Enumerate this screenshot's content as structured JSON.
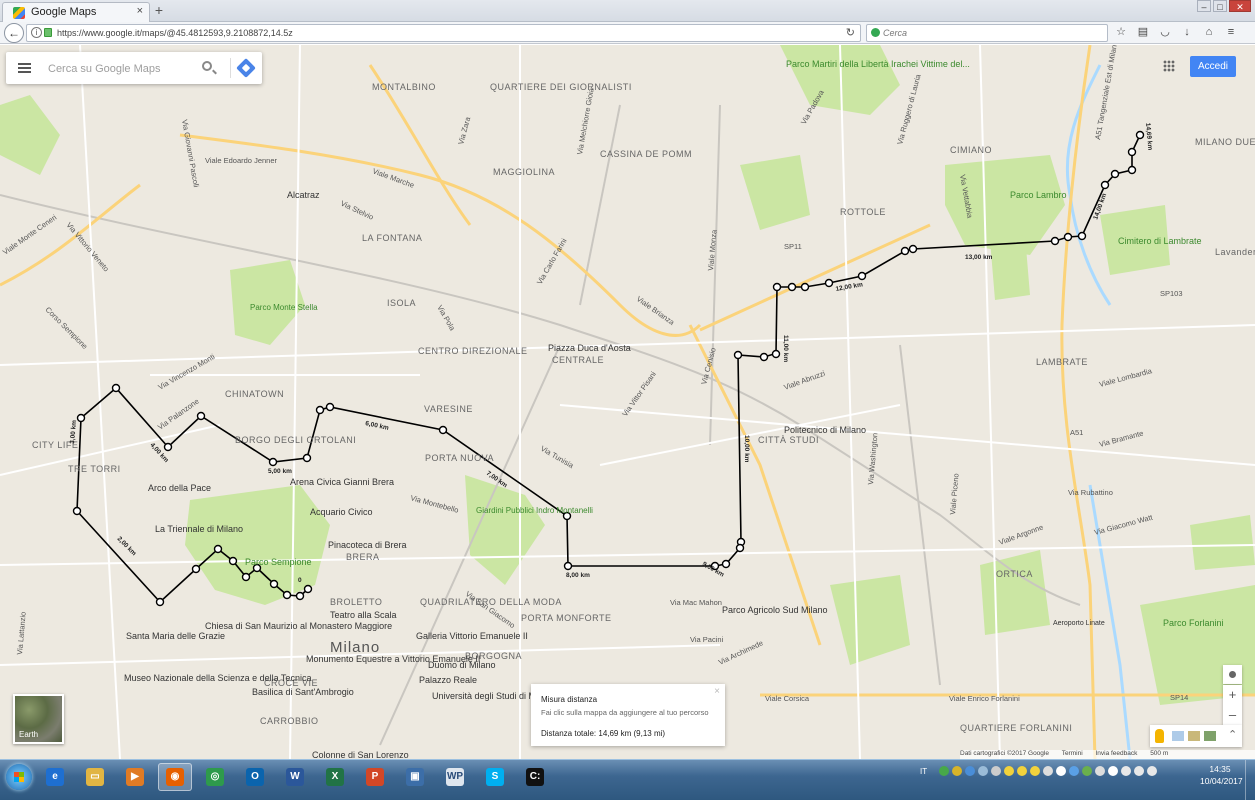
{
  "browser": {
    "tab_title": "Google Maps",
    "tab_close": "×",
    "new_tab": "+",
    "url": "https://www.google.it/maps/@45.4812593,9.2108872,14.5z",
    "search_placeholder": "Cerca",
    "window_buttons": [
      "–",
      "□",
      "✕"
    ]
  },
  "maps": {
    "search_placeholder": "Cerca su Google Maps",
    "sign_in": "Accedi",
    "earth_label": "Earth",
    "zoom_in": "+",
    "zoom_out": "–",
    "measure": {
      "title": "Misura distanza",
      "hint": "Fai clic sulla mappa da aggiungere al tuo percorso",
      "total": "Distanza totale: 14,69 km (9,13 mi)",
      "close": "×"
    },
    "footer": {
      "data": "Dati cartografici ©2017 Google",
      "terms": "Termini",
      "feedback": "Invia feedback",
      "scale": "500 m"
    },
    "district_labels": [
      "MONTALBINO",
      "QUARTIERE DEI GIORNALISTI",
      "CASSINA DE POMM",
      "MAGGIOLINA",
      "CIMIANO",
      "ROTTOLE",
      "LA FONTANA",
      "ISOLA",
      "CENTRO DIREZIONALE",
      "CENTRALE",
      "LAMBRATE",
      "CHINATOWN",
      "BORGO DEGLI ORTOLANI",
      "VARESINE",
      "PORTA NUOVA",
      "CITY LIFE",
      "TRE TORRI",
      "CITTÀ STUDI",
      "ORTICA",
      "BRERA",
      "BROLETTO",
      "QUADRILATERO DELLA MODA",
      "PORTA MONFORTE",
      "BORGOGNA",
      "CROCE VIE",
      "CARROBBIO",
      "QUARTIERE FORLANINI",
      "Milano",
      "MILANO DUE",
      "Lavander"
    ],
    "place_labels": [
      "Parco Monte Stella",
      "Alcatraz",
      "Parco Lambro",
      "Cimitero di Lambrate",
      "Piazza Duca d'Aosta",
      "Arco della Pace",
      "Arena Civica Gianni Brera",
      "Acquario Civico",
      "La Triennale di Milano",
      "Parco Sempione",
      "Pinacoteca di Brera",
      "Giardini Pubblici Indro Montanelli",
      "Politecnico di Milano",
      "Parco Agricolo Sud Milano",
      "Santa Maria delle Grazie",
      "Chiesa di San Maurizio al Monastero Maggiore",
      "Teatro alla Scala",
      "Galleria Vittorio Emanuele II",
      "Monumento Equestre a Vittorio Emanuele II",
      "Duomo di Milano",
      "Palazzo Reale",
      "Università degli Studi di Milano",
      "Museo Nazionale della Scienza e della Tecnica",
      "Basilica di Sant'Ambrogio",
      "Colonne di San Lorenzo",
      "Parco Forlanini",
      "Aeroporto Linate",
      "Parco Martiri della Libertà Irachei Vittime del..."
    ],
    "street_labels": [
      "Viale Edoardo Jenner",
      "Viale Marche",
      "Viale Monte Ceneri",
      "Via Zara",
      "Viale Brianza",
      "Via Padova",
      "Viale Enrico Forlanini",
      "Viale Corsica",
      "Via Rubattino",
      "Via Tunisia",
      "Via Vittor Pisani",
      "Corso Sempione",
      "Viale Monza",
      "SP11",
      "SP103",
      "SP14",
      "A51",
      "Via Palanzone",
      "Via Vincenzo Monti",
      "Via Ruggero di Lauria",
      "Via Pola",
      "Via Melchiorre Gioia",
      "Viale Lombardia",
      "Via Bramante",
      "Corso di Porta Romana",
      "Via Lazzaro Palazzi",
      "A51 Tangenziale Est di Milano",
      "Via Rombon",
      "Via Caduti di Marcinelle",
      "Via Raffaele Rubattino",
      "Via Marcona",
      "Via Archimede",
      "Via Pacini",
      "Viale Abruzzi",
      "Via Mac Mahon",
      "Via Cenisio",
      "Via Vittorio Veneto",
      "Via Giacomo Watt",
      "Viale Piceno",
      "Via Washington",
      "Via Vettabbia",
      "Via Lattanzio",
      "Viale Argonne",
      "Via Giovanni Pascoli",
      "Via Fermi",
      "Via Stelvio",
      "Via Carlo Farini",
      "Via Don Gnocchi",
      "Via Feltre",
      "Via Cimabue",
      "Via Dalmazia",
      "Via Bazzini",
      "Via Toscana",
      "Via Lomellina",
      "Via Montebello",
      "Via San Giacomo",
      "Via Fabio Filzi"
    ],
    "route_distances": [
      "14,69 km",
      "14,00 km",
      "13,00 km",
      "12,00 km",
      "11,00 km",
      "10,00 km",
      "9,00 km",
      "8,00 km",
      "7,00 km",
      "6,00 km",
      "5,00 km",
      "4,00 km",
      "3,00 km",
      "2,00 km",
      "0"
    ]
  },
  "taskbar": {
    "apps": [
      {
        "name": "internet-explorer",
        "color": "#1e6fd1",
        "glyph": "e"
      },
      {
        "name": "file-explorer",
        "color": "#e1b543",
        "glyph": "▭"
      },
      {
        "name": "media-player",
        "color": "#e07b25",
        "glyph": "▶"
      },
      {
        "name": "firefox",
        "color": "#e66000",
        "glyph": "◉"
      },
      {
        "name": "chrome",
        "color": "#2e9a4c",
        "glyph": "◎"
      },
      {
        "name": "outlook",
        "color": "#0a64ad",
        "glyph": "O"
      },
      {
        "name": "word",
        "color": "#2b579a",
        "glyph": "W"
      },
      {
        "name": "excel",
        "color": "#217346",
        "glyph": "X"
      },
      {
        "name": "powerpoint",
        "color": "#d24726",
        "glyph": "P"
      },
      {
        "name": "virtualbox",
        "color": "#3c6ea8",
        "glyph": "▣"
      },
      {
        "name": "wordperfect",
        "color": "#dfe6ee",
        "glyph": "WP"
      },
      {
        "name": "skype",
        "color": "#00aff0",
        "glyph": "S"
      },
      {
        "name": "command-prompt",
        "color": "#111111",
        "glyph": "C:"
      }
    ],
    "lang": "IT",
    "time": "14:35",
    "date": "10/04/2017"
  },
  "colors": {
    "map_bg": "#ede9e0",
    "park": "#cbe6a3",
    "water": "#aadaff",
    "highway": "#fbd37a",
    "accent": "#4285f4"
  }
}
